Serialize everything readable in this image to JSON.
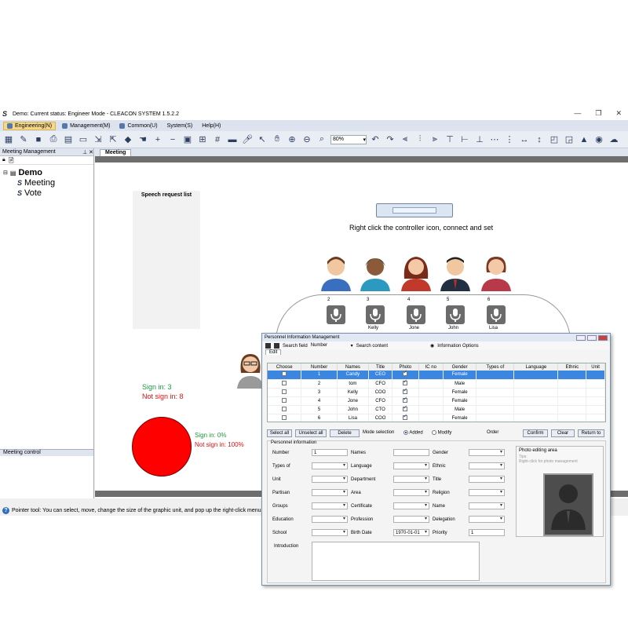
{
  "window": {
    "title": "Demo: Current status: Engineer Mode - CLEACON SYSTEM 1.5.2.2"
  },
  "menu": {
    "items": [
      "Engineering(N)",
      "Management(M)",
      "Common(U)",
      "System(S)",
      "Help(H)"
    ]
  },
  "toolbar": {
    "zoom_value": "80%"
  },
  "left_panel": {
    "title": "Meeting Management",
    "tree": {
      "root": "Demo",
      "children": [
        "Meeting",
        "Vote"
      ]
    },
    "meeting_control_title": "Meeting control"
  },
  "canvas": {
    "tab": "Meeting",
    "speech_list_title": "Speech request list",
    "controller_caption": "Right click the controller icon, connect and set",
    "seats": [
      {
        "num": "2",
        "name": "",
        "color": "#3a6fbf"
      },
      {
        "num": "3",
        "name": "Kelly",
        "color": "#2c9ac0"
      },
      {
        "num": "4",
        "name": "Jone",
        "color": "#c0392b"
      },
      {
        "num": "5",
        "name": "John",
        "color": "#222f40"
      },
      {
        "num": "6",
        "name": "Lisa",
        "color": "#b83a4a"
      }
    ],
    "sign_in": "Sign in: 3",
    "not_sign_in": "Not sign in: 8",
    "sign_in_pct": "Sign in: 0%",
    "not_sign_in_pct": "Not sign in: 100%",
    "pie": {
      "sign_in_percent": 0,
      "not_sign_in_percent": 100
    }
  },
  "statusbar": {
    "text": "Pointer tool: You can select, move, change the size of the graphic unit, and pop up the right-click menu"
  },
  "dialog": {
    "title": "Personnel Information Management",
    "search_field_label": "Search field",
    "search_field_value": "Number",
    "search_content_label": "Search content",
    "info_options": "Information Options",
    "tab": "Edit",
    "columns": [
      "Choose",
      "Number",
      "Names",
      "Title",
      "Photo",
      "IC no",
      "Gender",
      "Types of",
      "Language",
      "Ethnic",
      "Unit"
    ],
    "rows": [
      {
        "number": "1",
        "name": "Candy",
        "title": "CEO",
        "gender": "Female"
      },
      {
        "number": "2",
        "name": "tom",
        "title": "CFO",
        "gender": "Male"
      },
      {
        "number": "3",
        "name": "Kelly",
        "title": "COO",
        "gender": "Female"
      },
      {
        "number": "4",
        "name": "Jone",
        "title": "CFO",
        "gender": "Female"
      },
      {
        "number": "5",
        "name": "John",
        "title": "CTO",
        "gender": "Male"
      },
      {
        "number": "6",
        "name": "Lisa",
        "title": "COO",
        "gender": "Female"
      }
    ],
    "buttons": {
      "select_all": "Select all",
      "unselect_all": "Unselect all",
      "delete": "Delete",
      "confirm": "Confirm",
      "clear": "Clear",
      "return_to": "Return to"
    },
    "mode_selection": "Mode selection",
    "mode_added": "Added",
    "mode_modify": "Modify",
    "order": "Order",
    "personnel_info": "Personnel information",
    "fields": {
      "number_label": "Number",
      "number_value": "1",
      "names": "Names",
      "gender": "Gender",
      "types_of": "Types of",
      "language": "Language",
      "ethnic": "Ethnic",
      "unit": "Unit",
      "department": "Department",
      "title": "Title",
      "partisan": "Partisan",
      "area": "Area",
      "religion": "Religion",
      "groups": "Groups",
      "certificate": "Certificate",
      "name": "Name",
      "education": "Education",
      "profession": "Profession",
      "delegation": "Delegation",
      "school": "School",
      "birth_date": "Birth Date",
      "birth_date_value": "1970-01-01",
      "priority": "Priority",
      "priority_value": "1",
      "introduction": "Introduction"
    },
    "photo": {
      "title": "Photo editing area",
      "tips": "Tips:",
      "hint": "Right-click for photo management"
    }
  }
}
